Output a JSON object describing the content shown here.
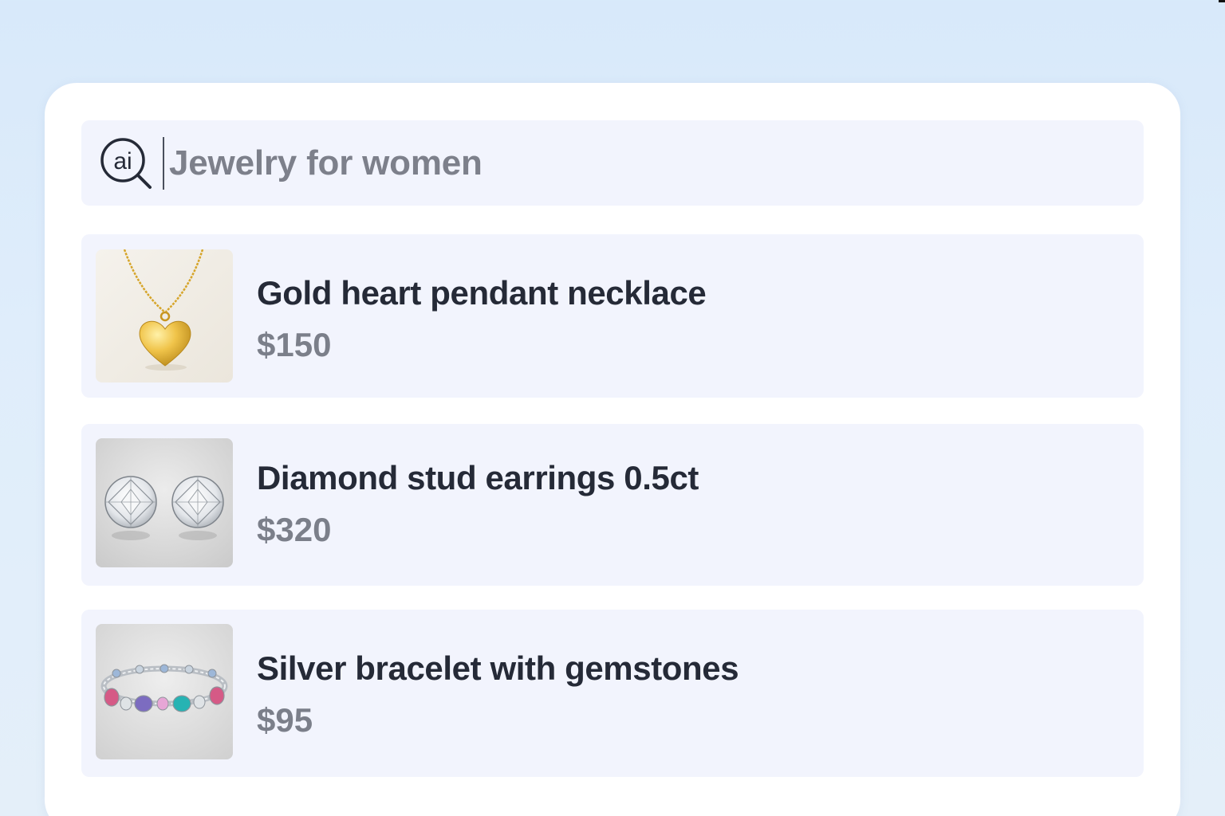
{
  "search": {
    "query": "Jewelry for women",
    "icon": "ai-search-icon",
    "icon_text": "ai"
  },
  "results": [
    {
      "title": "Gold heart pendant necklace",
      "price": "$150",
      "image_icon": "gold-heart-necklace-image"
    },
    {
      "title": "Diamond stud earrings 0.5ct",
      "price": "$320",
      "image_icon": "diamond-earrings-image"
    },
    {
      "title": "Silver bracelet with gemstones",
      "price": "$95",
      "image_icon": "gemstone-bracelet-image"
    }
  ],
  "colors": {
    "background": "#d8e9fa",
    "panel": "#ffffff",
    "card": "#f2f4fd",
    "title_text": "#252a37",
    "price_text": "#7b7f8a",
    "placeholder_text": "#7d808b"
  }
}
